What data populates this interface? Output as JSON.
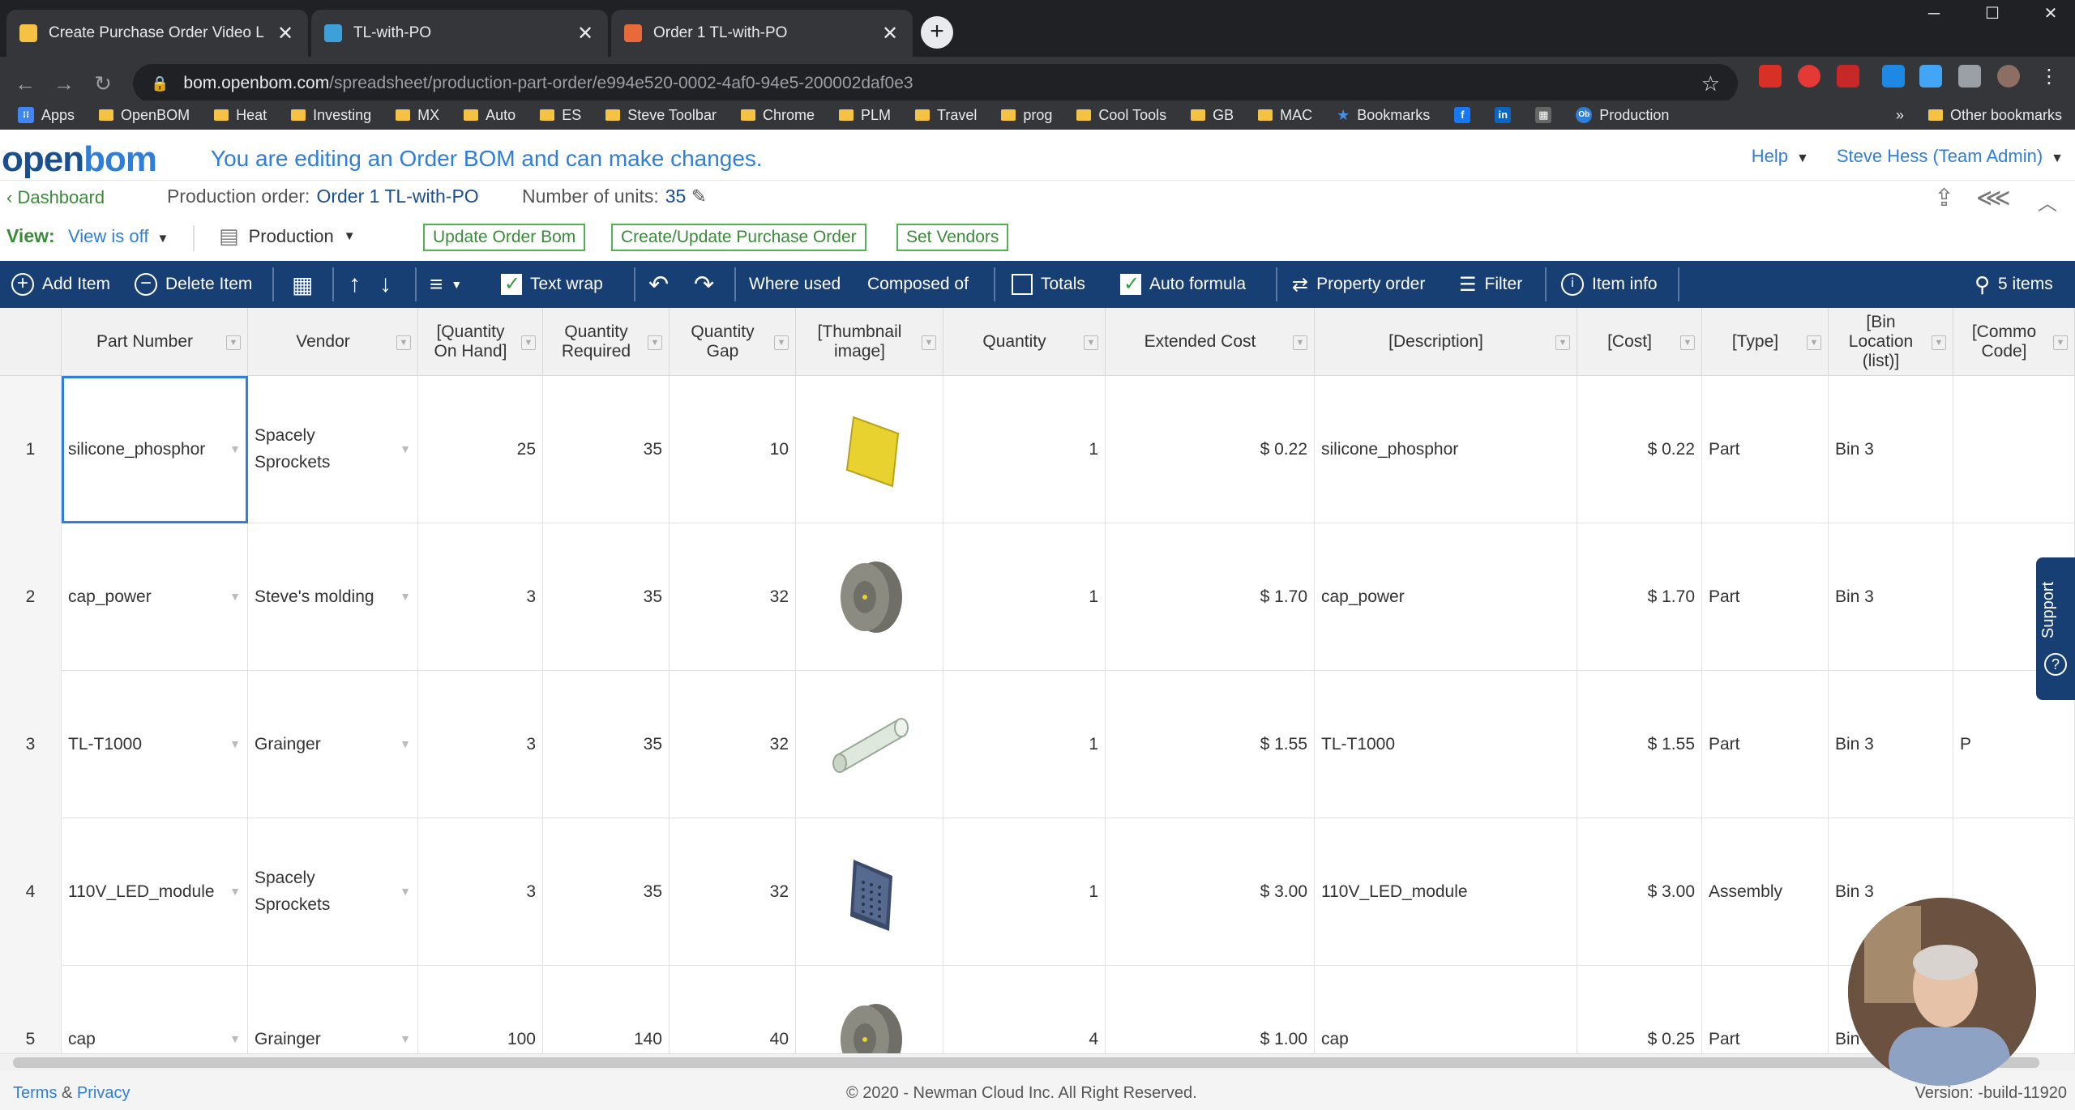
{
  "browser": {
    "tabs": [
      {
        "title": "Create Purchase Order Video Les",
        "color": "#f6c244"
      },
      {
        "title": "TL-with-PO",
        "color": "#3ea0d8"
      },
      {
        "title": "Order 1 TL-with-PO",
        "color": "#e86a3a"
      }
    ],
    "url_host": "bom.openbom.com",
    "url_path": "/spreadsheet/production-part-order/e994e520-0002-4af0-94e5-200002daf0e3",
    "bookmarks": [
      "Apps",
      "OpenBOM",
      "Heat",
      "Investing",
      "MX",
      "Auto",
      "ES",
      "Steve Toolbar",
      "Chrome",
      "PLM",
      "Travel",
      "prog",
      "Cool Tools",
      "GB",
      "MAC",
      "Bookmarks"
    ],
    "bookmark_more": "»",
    "bookmark_production": "Production",
    "other_bookmarks": "Other bookmarks"
  },
  "header": {
    "logo": "openbom",
    "editing_msg": "You are editing an Order BOM and can make changes.",
    "help": "Help",
    "user": "Steve Hess (Team Admin)"
  },
  "subheader": {
    "dashboard": "Dashboard",
    "po_label": "Production order:",
    "po_value": "Order 1 TL-with-PO",
    "units_label": "Number of units:",
    "units_value": "35"
  },
  "viewbar": {
    "view_label": "View:",
    "view_value": "View is off",
    "production": "Production",
    "update_btn": "Update Order Bom",
    "create_po_btn": "Create/Update Purchase Order",
    "vendors_btn": "Set Vendors"
  },
  "toolbar": {
    "add_item": "Add Item",
    "delete_item": "Delete Item",
    "text_wrap": "Text wrap",
    "where_used": "Where used",
    "composed_of": "Composed of",
    "totals": "Totals",
    "auto_formula": "Auto formula",
    "property_order": "Property order",
    "filter": "Filter",
    "item_info": "Item info",
    "items_count": "5 items",
    "text_wrap_checked": true,
    "totals_checked": false,
    "auto_formula_checked": true
  },
  "columns": [
    "Part Number",
    "Vendor",
    "[Quantity On Hand]",
    "Quantity Required",
    "Quantity Gap",
    "[Thumbnail image]",
    "Quantity",
    "Extended Cost",
    "[Description]",
    "[Cost]",
    "[Type]",
    "[Bin Location (list)]",
    "[Commo Code]"
  ],
  "rows": [
    {
      "n": "1",
      "part": "silicone_phosphor",
      "vendor": "Spacely\nSprockets",
      "onhand": "25",
      "req": "35",
      "gap": "10",
      "thumb": "yellow-square",
      "qty": "1",
      "ext": "$ 0.22",
      "desc": "silicone_phosphor",
      "cost": "$ 0.22",
      "type": "Part",
      "bin": "Bin 3",
      "comm": ""
    },
    {
      "n": "2",
      "part": "cap_power",
      "vendor": "Steve's molding",
      "onhand": "3",
      "req": "35",
      "gap": "32",
      "thumb": "gray-cap",
      "qty": "1",
      "ext": "$ 1.70",
      "desc": "cap_power",
      "cost": "$ 1.70",
      "type": "Part",
      "bin": "Bin 3",
      "comm": ""
    },
    {
      "n": "3",
      "part": "TL-T1000",
      "vendor": "Grainger",
      "onhand": "3",
      "req": "35",
      "gap": "32",
      "thumb": "tube",
      "qty": "1",
      "ext": "$ 1.55",
      "desc": "TL-T1000",
      "cost": "$ 1.55",
      "type": "Part",
      "bin": "Bin 3",
      "comm": "P"
    },
    {
      "n": "4",
      "part": "110V_LED_module",
      "vendor": "Spacely\nSprockets",
      "onhand": "3",
      "req": "35",
      "gap": "32",
      "thumb": "led-module",
      "qty": "1",
      "ext": "$ 3.00",
      "desc": "110V_LED_module",
      "cost": "$ 3.00",
      "type": "Assembly",
      "bin": "Bin 3",
      "comm": ""
    },
    {
      "n": "5",
      "part": "cap",
      "vendor": "Grainger",
      "onhand": "100",
      "req": "140",
      "gap": "40",
      "thumb": "gray-cap",
      "qty": "4",
      "ext": "$ 1.00",
      "desc": "cap",
      "cost": "$ 0.25",
      "type": "Part",
      "bin": "Bin",
      "comm": ""
    }
  ],
  "footer": {
    "terms": "Terms",
    "amp": "&",
    "privacy": "Privacy",
    "copyright": "© 2020 - Newman Cloud Inc. All Right Reserved.",
    "version": "Version: -build-11920"
  },
  "support": "Support"
}
